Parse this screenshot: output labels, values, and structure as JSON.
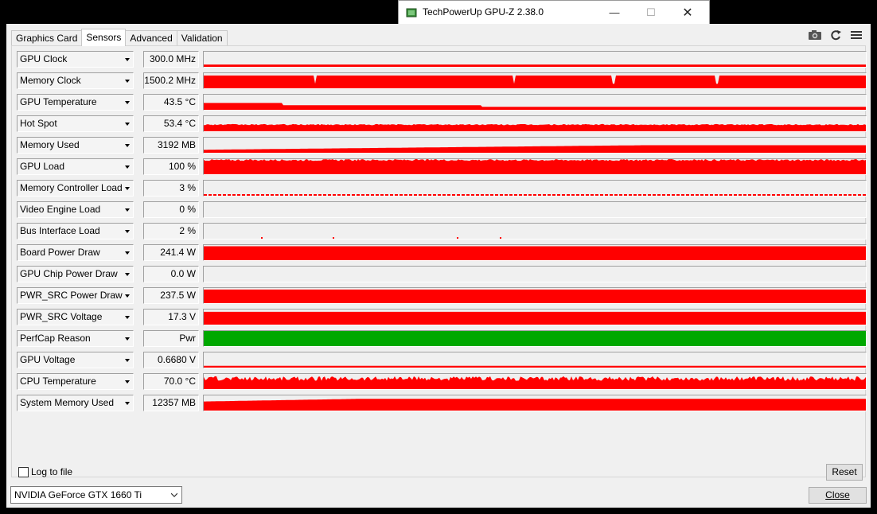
{
  "window": {
    "title": "TechPowerUp GPU-Z 2.38.0",
    "controls": {
      "minimize": "—",
      "maximize": "☐",
      "close": "✕"
    }
  },
  "tabs": [
    {
      "label": "Graphics Card",
      "active": false
    },
    {
      "label": "Sensors",
      "active": true
    },
    {
      "label": "Advanced",
      "active": false
    },
    {
      "label": "Validation",
      "active": false
    }
  ],
  "toolbar": {
    "icons": [
      "camera-icon",
      "refresh-icon",
      "menu-icon"
    ]
  },
  "colors": {
    "graph_red": "#ff0000",
    "graph_green": "#00a800"
  },
  "sensors": [
    {
      "name": "GPU Clock",
      "value": "300.0 MHz",
      "level": 0.15,
      "pattern": "low"
    },
    {
      "name": "Memory Clock",
      "value": "1500.2 MHz",
      "level": 0.85,
      "pattern": "full-dips"
    },
    {
      "name": "GPU Temperature",
      "value": "43.5 °C",
      "level": 0.25,
      "pattern": "low-hump"
    },
    {
      "name": "Hot Spot",
      "value": "53.4 °C",
      "level": 0.45,
      "pattern": "mid"
    },
    {
      "name": "Memory Used",
      "value": "3192 MB",
      "level": 0.5,
      "pattern": "ramp"
    },
    {
      "name": "GPU Load",
      "value": "100 %",
      "level": 0.95,
      "pattern": "noisy-high"
    },
    {
      "name": "Memory Controller Load",
      "value": "3 %",
      "level": 0.05,
      "pattern": "sparse"
    },
    {
      "name": "Video Engine Load",
      "value": "0 %",
      "level": 0,
      "pattern": "empty"
    },
    {
      "name": "Bus Interface Load",
      "value": "2 %",
      "level": 0.05,
      "pattern": "specks"
    },
    {
      "name": "Board Power Draw",
      "value": "241.4 W",
      "level": 0.92,
      "pattern": "full"
    },
    {
      "name": "GPU Chip Power Draw",
      "value": "0.0 W",
      "level": 0,
      "pattern": "empty"
    },
    {
      "name": "PWR_SRC Power Draw",
      "value": "237.5 W",
      "level": 0.9,
      "pattern": "full"
    },
    {
      "name": "PWR_SRC Voltage",
      "value": "17.3 V",
      "level": 0.85,
      "pattern": "full"
    },
    {
      "name": "PerfCap Reason",
      "value": "Pwr",
      "level": 1,
      "pattern": "green"
    },
    {
      "name": "GPU Voltage",
      "value": "0.6680 V",
      "level": 0.12,
      "pattern": "low"
    },
    {
      "name": "CPU Temperature",
      "value": "70.0 °C",
      "level": 0.75,
      "pattern": "noisy-mid"
    },
    {
      "name": "System Memory Used",
      "value": "12357 MB",
      "level": 0.78,
      "pattern": "ramp-high"
    }
  ],
  "log": {
    "label": "Log to file",
    "checked": false
  },
  "reset_label": "Reset",
  "gpu_select": {
    "value": "NVIDIA GeForce GTX 1660 Ti"
  },
  "close_label": "Close"
}
